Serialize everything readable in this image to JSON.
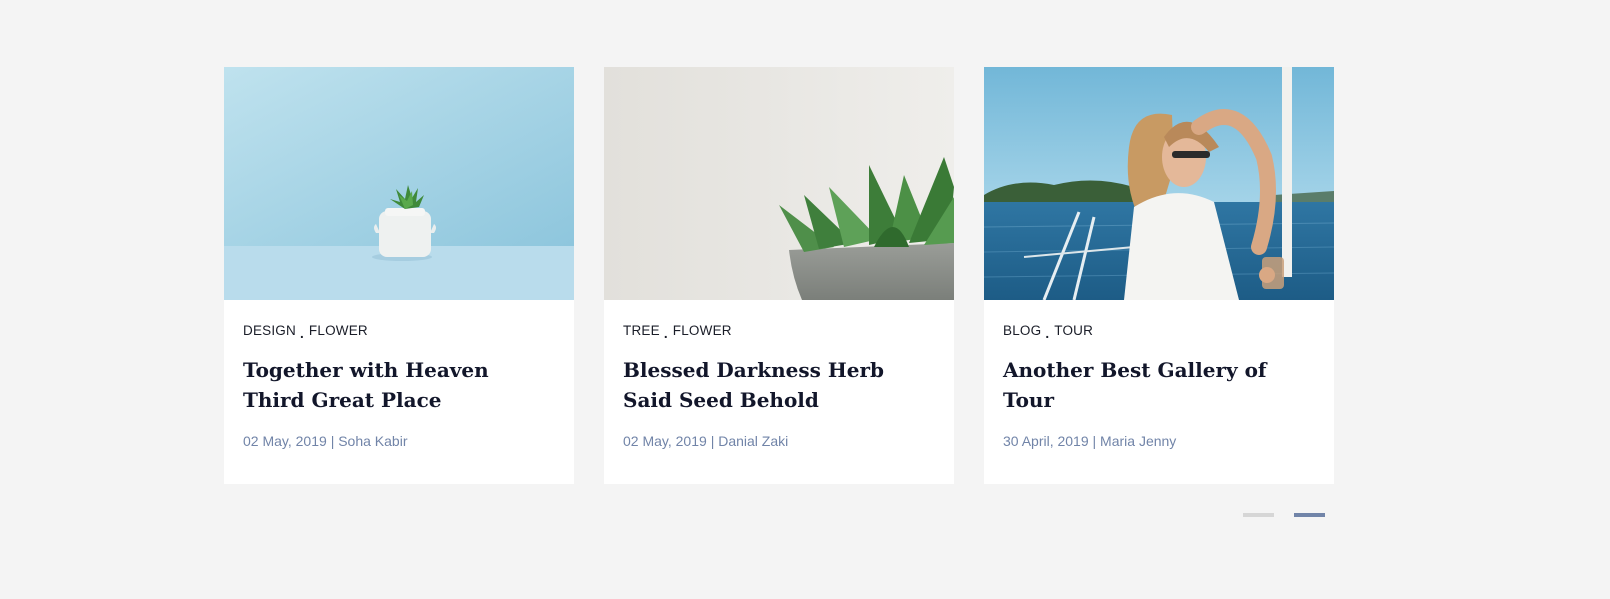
{
  "posts": [
    {
      "image": "potted-succulent-blue-background",
      "categories": [
        "DESIGN",
        "FLOWER"
      ],
      "title": "Together with Heaven Third Great Place",
      "date": "02 May, 2019",
      "author": "Soha Kabir"
    },
    {
      "image": "succulent-in-grey-pot",
      "categories": [
        "TREE",
        "FLOWER"
      ],
      "title": "Blessed Darkness Herb Said Seed Behold",
      "date": "02 May, 2019",
      "author": "Danial Zaki"
    },
    {
      "image": "woman-on-sailboat",
      "categories": [
        "BLOG",
        "TOUR"
      ],
      "title": "Another Best Gallery of Tour",
      "date": "30 April, 2019",
      "author": "Maria Jenny"
    }
  ],
  "separator_glyph": ".",
  "meta_divider": "|",
  "pager": {
    "pages": 2,
    "active_index": 1
  },
  "colors": {
    "background": "#f4f4f4",
    "card": "#ffffff",
    "title": "#12162a",
    "meta": "#7184a8",
    "pager_inactive": "#d6d6d6",
    "pager_active": "#7184a8"
  }
}
